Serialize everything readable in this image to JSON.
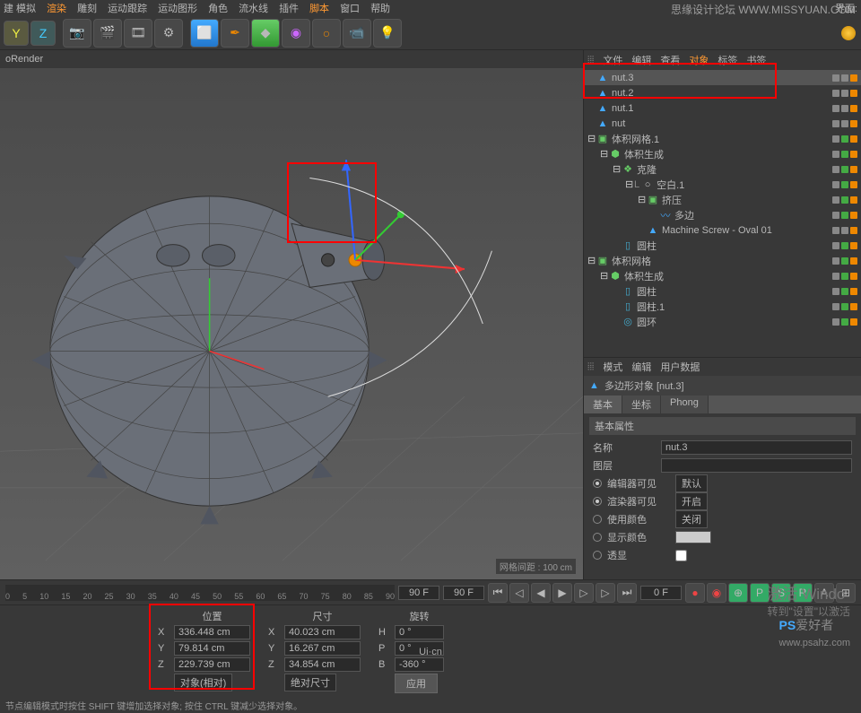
{
  "watermark_top": "思缘设计论坛  WWW.MISSYUAN.COM",
  "watermark_bot": "PS爱好者\nwww.psahz.com",
  "activate": {
    "line1": "激活 Windo",
    "line2": "转到\"设置\"以激活"
  },
  "ui_cn": "Ui·cn",
  "top_menu": [
    "建  模拟",
    "渲染",
    "雕刻",
    "运动跟踪",
    "运动图形",
    "角色",
    "流水线",
    "插件",
    "脚本",
    "窗口",
    "帮助"
  ],
  "top_right": "界面:",
  "viewport_title": "oRender",
  "grid_label": "网格间距 : 100 cm",
  "obj_tabs": [
    "文件",
    "编辑",
    "查看",
    "对象",
    "标签",
    "书签"
  ],
  "tree": [
    {
      "indent": 0,
      "icon": "poly",
      "label": "nut.3",
      "sel": true
    },
    {
      "indent": 0,
      "icon": "poly",
      "label": "nut.2"
    },
    {
      "indent": 0,
      "icon": "poly",
      "label": "nut.1"
    },
    {
      "indent": 0,
      "icon": "poly",
      "label": "nut"
    },
    {
      "indent": 0,
      "icon": "vol",
      "label": "体积网格.1",
      "exp": "-"
    },
    {
      "indent": 1,
      "icon": "gen",
      "label": "体积生成",
      "exp": "-"
    },
    {
      "indent": 2,
      "icon": "clone",
      "label": "克隆",
      "exp": "-"
    },
    {
      "indent": 3,
      "icon": "null",
      "label": "空白.1",
      "exp": "-",
      "pre": "L"
    },
    {
      "indent": 4,
      "icon": "ext",
      "label": "挤压",
      "exp": "-"
    },
    {
      "indent": 5,
      "icon": "spline",
      "label": "多边"
    },
    {
      "indent": 4,
      "icon": "poly",
      "label": "Machine Screw - Oval 01"
    },
    {
      "indent": 2,
      "icon": "cyl",
      "label": "圆柱"
    },
    {
      "indent": 0,
      "icon": "vol",
      "label": "体积网格",
      "exp": "-"
    },
    {
      "indent": 1,
      "icon": "gen",
      "label": "体积生成",
      "exp": "-"
    },
    {
      "indent": 2,
      "icon": "cyl",
      "label": "圆柱"
    },
    {
      "indent": 2,
      "icon": "cyl",
      "label": "圆柱.1"
    },
    {
      "indent": 2,
      "icon": "ring",
      "label": "圆环"
    }
  ],
  "attr_tabs": [
    "模式",
    "编辑",
    "用户数据"
  ],
  "attr_obj": "多边形对象 [nut.3]",
  "attr_subtabs": [
    "基本",
    "坐标",
    "Phong"
  ],
  "attr_section": "基本属性",
  "attr_rows": {
    "name_label": "名称",
    "name_val": "nut.3",
    "layer_label": "图层",
    "editor_label": "编辑器可见",
    "editor_val": "默认",
    "render_label": "渲染器可见",
    "render_val": "开启",
    "usecolor_label": "使用颜色",
    "usecolor_val": "关闭",
    "showcolor_label": "显示颜色",
    "xray_label": "透显"
  },
  "timeline": {
    "ticks": [
      "0",
      "5",
      "10",
      "15",
      "20",
      "25",
      "30",
      "35",
      "40",
      "45",
      "50",
      "55",
      "60",
      "65",
      "70",
      "75",
      "80",
      "85",
      "90"
    ],
    "frame_start": "0 F",
    "frame_end": "90 F",
    "frame_cur": "90 F",
    "frame_total": "0 F"
  },
  "coord": {
    "pos_label": "位置",
    "size_label": "尺寸",
    "rot_label": "旋转",
    "x": "336.448 cm",
    "y": "79.814 cm",
    "z": "229.739 cm",
    "sx": "40.023 cm",
    "sy": "16.267 cm",
    "sz": "34.854 cm",
    "h": "0 °",
    "p": "0 °",
    "b": "-360 °",
    "rel": "对象(相对)",
    "abs": "绝对尺寸",
    "apply": "应用"
  },
  "status": "节点编辑模式时按住 SHIFT 键增加选择对象; 按住 CTRL 键减少选择对象。"
}
